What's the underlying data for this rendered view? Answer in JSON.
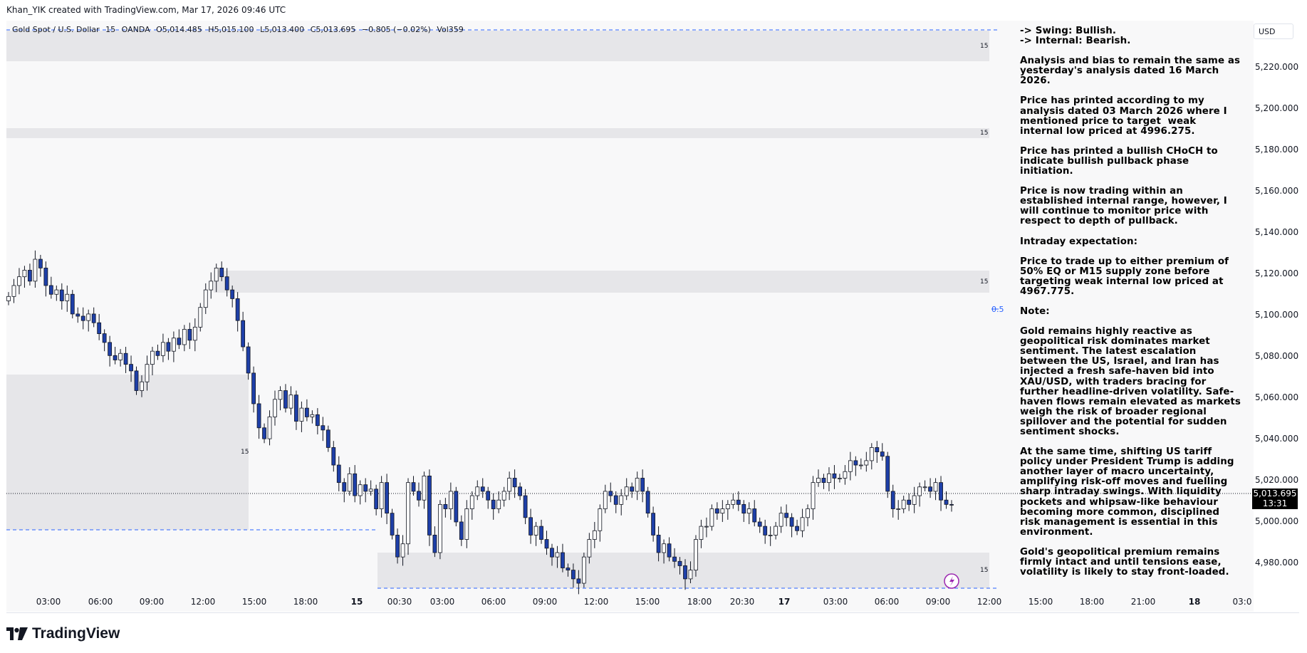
{
  "header": {
    "credit": "Khan_YIK created with TradingView.com, Mar 17, 2026 09:46 UTC"
  },
  "legend": {
    "symbol": "Gold Spot / U.S. Dollar",
    "interval": "15",
    "broker": "OANDA",
    "open": "O5,014.485",
    "high": "H5,015.100",
    "low": "L5,013.400",
    "close": "C5,013.695",
    "change": "−0.805 (−0.02%)",
    "volume": "Vol359"
  },
  "note": {
    "paragraphs": [
      "-> Swing: Bullish.\n-> Internal: Bearish.",
      "Analysis and bias to remain the same as yesterday's analysis dated 16 March 2026.",
      "Price has printed according to my analysis dated 03 March 2026 where I mentioned price to target  weak internal low priced at 4996.275.",
      "Price has printed a bullish CHoCH to indicate bullish pullback phase initiation.",
      "Price is now trading within an established internal range, however, I will continue to monitor price with respect to depth of pullback.",
      "Intraday expectation:",
      "Price to trade up to either premium of 50% EQ or M15 supply zone before targeting weak internal low priced at 4967.775.",
      "Note:",
      "Gold remains highly reactive as geopolitical risk dominates market sentiment. The latest escalation between the US, Israel, and Iran has injected a fresh safe-haven bid into XAU/USD, with traders bracing for further headline-driven volatility. Safe-haven flows remain elevated as markets weigh the risk of broader regional spillover and the potential for sudden sentiment shocks.",
      "At the same time, shifting US tariff policy under President Trump is adding another layer of macro uncertainty, amplifying risk-off moves and fuelling sharp intraday swings. With liquidity pockets and whipsaw-like behaviour becoming more common, disciplined risk management is essential in this environment.",
      "Gold's geopolitical premium remains firmly intact and until tensions ease, volatility is likely to stay front-loaded."
    ]
  },
  "price_scale": {
    "currency": "USD",
    "labels": [
      "5,220.000",
      "5,200.000",
      "5,180.000",
      "5,160.000",
      "5,140.000",
      "5,120.000",
      "5,100.000",
      "5,080.000",
      "5,060.000",
      "5,040.000",
      "5,020.000",
      "5,000.000",
      "4,980.000"
    ],
    "last_price": "5,013.695",
    "countdown": "13:31"
  },
  "time_axis": {
    "labels": [
      "03:00",
      "06:00",
      "09:00",
      "12:00",
      "15:00",
      "18:00",
      "15",
      "00:30",
      "03:00",
      "06:00",
      "09:00",
      "12:00",
      "15:00",
      "18:00",
      "20:30",
      "17",
      "03:00",
      "06:00",
      "09:00",
      "12:00",
      "15:00",
      "18:00",
      "21:00",
      "18",
      "03:0"
    ]
  },
  "annotations": {
    "zone_label": "15",
    "half_level": "0.5"
  },
  "brand": {
    "name": "TradingView"
  },
  "colors": {
    "candle_up": "#ffffff",
    "candle_down": "#1e3fa8",
    "wick": "#131722",
    "zone": "#e6e6e9",
    "dash": "#2962ff",
    "last_price_bg": "#000000",
    "alert": "#9c27b0"
  },
  "chart_data": {
    "type": "candlestick",
    "ylim": [
      4965,
      5235
    ],
    "last": 5013.695,
    "closes": [
      5109,
      5114,
      5118,
      5121,
      5116,
      5126,
      5122,
      5114,
      5110,
      5112,
      5107,
      5110,
      5101,
      5100,
      5098,
      5101,
      5097,
      5092,
      5088,
      5082,
      5080,
      5083,
      5078,
      5075,
      5066,
      5070,
      5078,
      5084,
      5082,
      5088,
      5084,
      5090,
      5087,
      5094,
      5089,
      5095,
      5104,
      5112,
      5116,
      5122,
      5118,
      5112,
      5108,
      5098,
      5086,
      5074,
      5060,
      5049,
      5044,
      5054,
      5062,
      5066,
      5058,
      5064,
      5052,
      5058,
      5054,
      5055,
      5050,
      5048,
      5040,
      5032,
      5024,
      5020,
      5028,
      5018,
      5023,
      5020,
      5021,
      5012,
      5024,
      5010,
      5000,
      4990,
      4996,
      5024,
      5020,
      5016,
      5027,
      5000,
      4992,
      5014,
      5012,
      5020,
      5006,
      4998,
      5012,
      5018,
      5022,
      5020,
      5016,
      5012,
      5016,
      5020,
      5026,
      5022,
      5018,
      5008,
      5000,
      5004,
      4998,
      4994,
      4990,
      4992,
      4985,
      4984,
      4980,
      4978,
      4990,
      4998,
      5002,
      5012,
      5020,
      5018,
      5014,
      5018,
      5022,
      5020,
      5026,
      5020,
      5010,
      5000,
      4992,
      4996,
      4990,
      4988,
      4986,
      4980,
      4984,
      4998,
      5004,
      5004,
      5012,
      5010,
      5012,
      5014,
      5016,
      5014,
      5010,
      5012,
      5006,
      5004,
      5000,
      5000,
      5004,
      5010,
      5008,
      5004,
      5002,
      5008,
      5012,
      5024,
      5026,
      5024,
      5028,
      5026,
      5026,
      5029,
      5034,
      5032,
      5032,
      5034,
      5040,
      5038,
      5036,
      5020,
      5012,
      5012,
      5016,
      5014,
      5018,
      5022,
      5022,
      5020,
      5024,
      5016,
      5014,
      5013.695
    ]
  }
}
